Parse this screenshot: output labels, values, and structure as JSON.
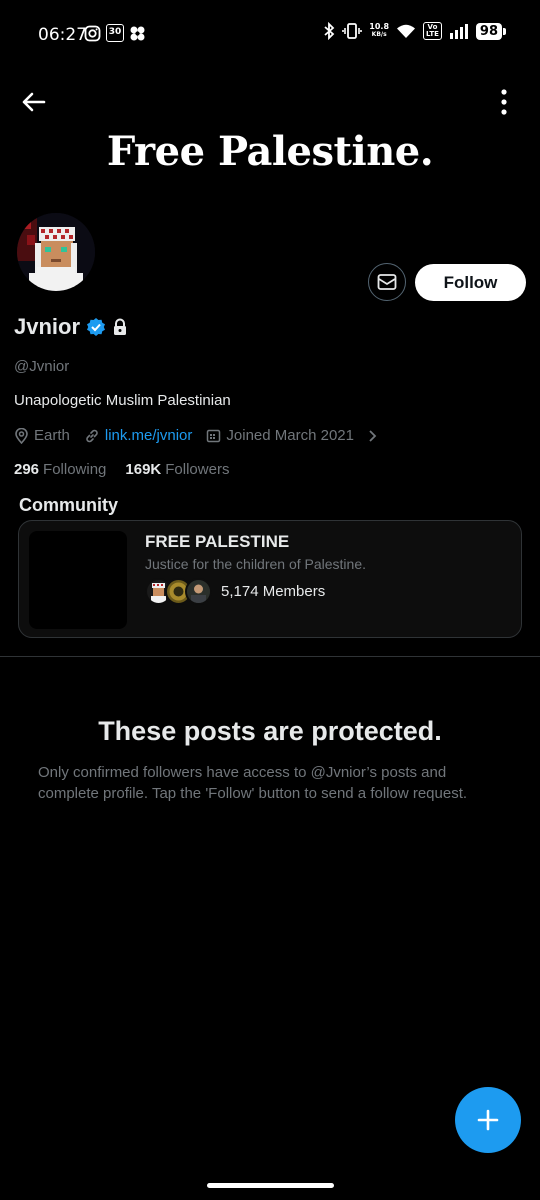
{
  "status_bar": {
    "time": "06:27",
    "net_speed_value": "10.8",
    "net_speed_unit": "KB/s",
    "lte_top": "Vo",
    "lte_bottom": "LTE",
    "battery": "98",
    "calendar_day": "30"
  },
  "header": {
    "banner_text": "Free Palestine."
  },
  "profile": {
    "name": "Jvnior",
    "handle": "@Jvnior",
    "bio": "Unapologetic Muslim Palestinian",
    "location": "Earth",
    "link": "link.me/jvnior",
    "joined": "Joined March 2021",
    "following_count": "296",
    "following_label": "Following",
    "followers_count": "169K",
    "followers_label": "Followers"
  },
  "actions": {
    "follow_label": "Follow"
  },
  "community": {
    "section_title": "Community",
    "name": "FREE PALESTINE",
    "description": "Justice for the children of Palestine.",
    "members": "5,174 Members"
  },
  "protected": {
    "title": "These posts are protected.",
    "body": "Only confirmed followers have access to @Jvnior’s posts and complete profile. Tap the 'Follow' button to send a follow request."
  },
  "colors": {
    "accent": "#1d9bf0",
    "background": "#000000",
    "secondary_text": "#71767b"
  }
}
